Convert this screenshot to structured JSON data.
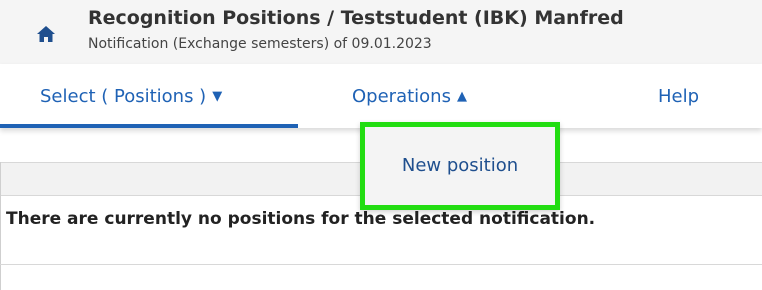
{
  "header": {
    "title": "Recognition Positions  / Teststudent (IBK) Manfred",
    "subtitle": "Notification (Exchange semesters) of 09.01.2023",
    "home_icon": "home-icon"
  },
  "nav": {
    "select_label": "Select ( Positions )",
    "operations_label": "Operations",
    "help_label": "Help",
    "select_caret": "▼",
    "operations_caret": "▲",
    "active_tab": "select"
  },
  "dropdown": {
    "new_position_label": "New position",
    "highlight_color": "#22dd11"
  },
  "content": {
    "empty_message": "There are currently no positions for the selected notification."
  },
  "colors": {
    "accent": "#1f62b5",
    "header_bg": "#f5f5f5"
  }
}
